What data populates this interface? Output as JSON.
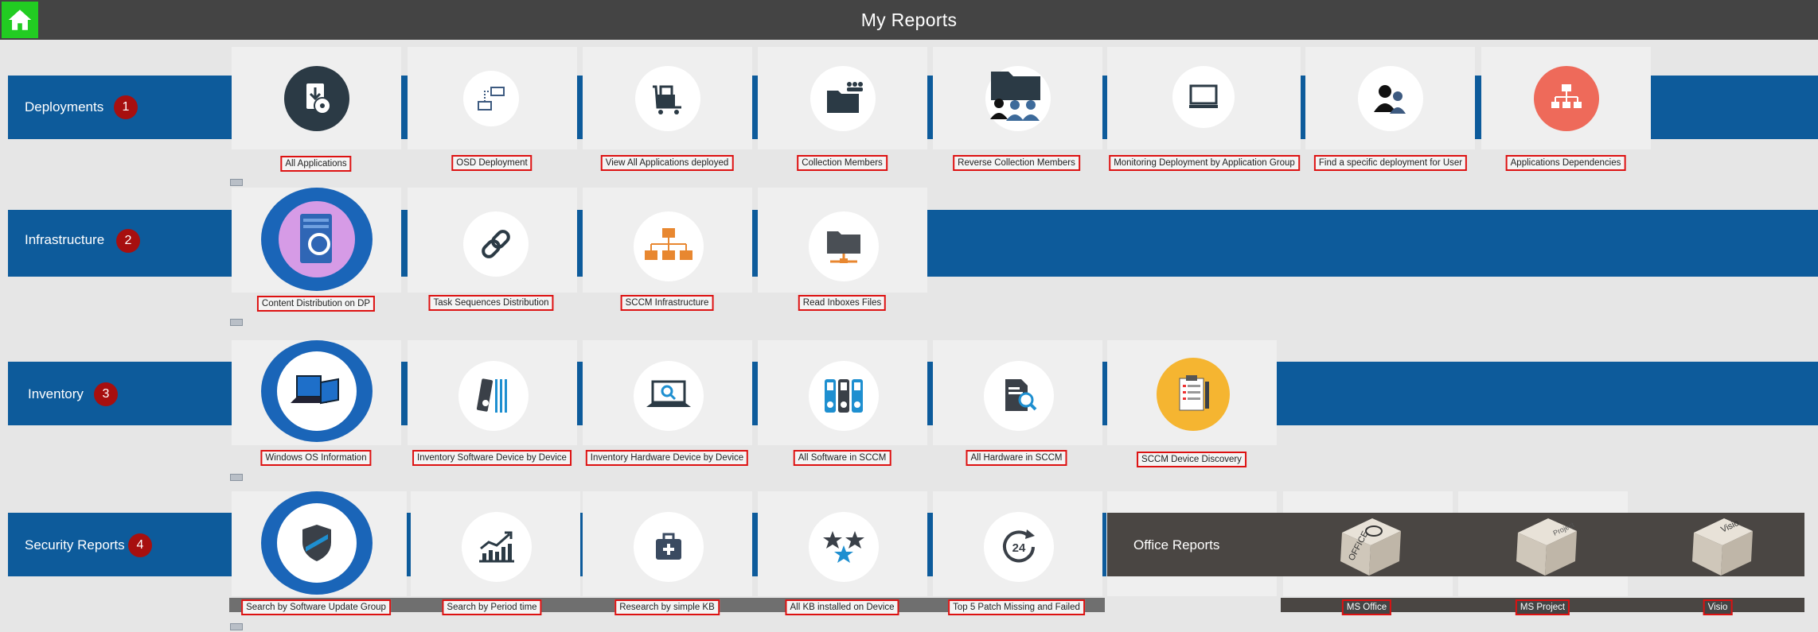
{
  "header": {
    "title": "My Reports",
    "home_icon": "home-icon"
  },
  "sections": [
    {
      "label": "Deployments",
      "badge": "1"
    },
    {
      "label": "Infrastructure",
      "badge": "2"
    },
    {
      "label": "Inventory",
      "badge": "3"
    },
    {
      "label": "Security Reports",
      "badge": "4"
    }
  ],
  "deployments": [
    {
      "label": "All Applications",
      "icon": "install-disc-icon"
    },
    {
      "label": "OSD Deployment",
      "icon": "osd-network-icon"
    },
    {
      "label": "View All Applications deployed",
      "icon": "cart-icon"
    },
    {
      "label": "Collection Members",
      "icon": "folder-users-icon"
    },
    {
      "label": "Reverse Collection Members",
      "icon": "folder-users-reverse-icon"
    },
    {
      "label": "Monitoring Deployment by Application Group",
      "icon": "monitor-icon"
    },
    {
      "label": "Find a specific deployment for User",
      "icon": "users-icon"
    },
    {
      "label": "Applications Dependencies",
      "icon": "hierarchy-icon"
    }
  ],
  "infrastructure": [
    {
      "label": "Content Distribution on DP",
      "icon": "server-sync-icon"
    },
    {
      "label": "Task Sequences Distribution",
      "icon": "chain-link-icon"
    },
    {
      "label": "SCCM Infrastructure",
      "icon": "org-chart-icon"
    },
    {
      "label": "Read Inboxes Files",
      "icon": "network-folder-icon"
    }
  ],
  "inventory": [
    {
      "label": "Windows OS Information",
      "icon": "windows-devices-icon"
    },
    {
      "label": "Inventory Software Device by Device",
      "icon": "binder-icon"
    },
    {
      "label": "Inventory Hardware Device by Device",
      "icon": "laptop-search-icon"
    },
    {
      "label": "All Software in SCCM",
      "icon": "binders-icon"
    },
    {
      "label": "All Hardware in SCCM",
      "icon": "document-search-icon"
    },
    {
      "label": "SCCM Device Discovery",
      "icon": "clipboard-icon"
    }
  ],
  "security": [
    {
      "label": "Search by Software Update Group",
      "icon": "shield-icon"
    },
    {
      "label": "Search by Period time",
      "icon": "trend-chart-icon"
    },
    {
      "label": "Research by simple KB",
      "icon": "medkit-icon"
    },
    {
      "label": "All KB installed on Device",
      "icon": "stars-icon"
    },
    {
      "label": "Top 5 Patch Missing and Failed",
      "icon": "clock-24-icon"
    }
  ],
  "office": {
    "title": "Office Reports",
    "items": [
      {
        "label": "MS Office",
        "cube_text": "OFFICE",
        "icon": "office-cube-icon"
      },
      {
        "label": "MS Project",
        "cube_text": "Project",
        "icon": "project-cube-icon"
      },
      {
        "label": "Visio",
        "cube_text": "Visio",
        "icon": "visio-cube-icon"
      }
    ]
  },
  "colors": {
    "band_blue": "#0d5b9b",
    "badge_red": "#a70f0f",
    "label_border": "#dd1111",
    "home_green": "#22cc22",
    "header_gray": "#444444"
  }
}
